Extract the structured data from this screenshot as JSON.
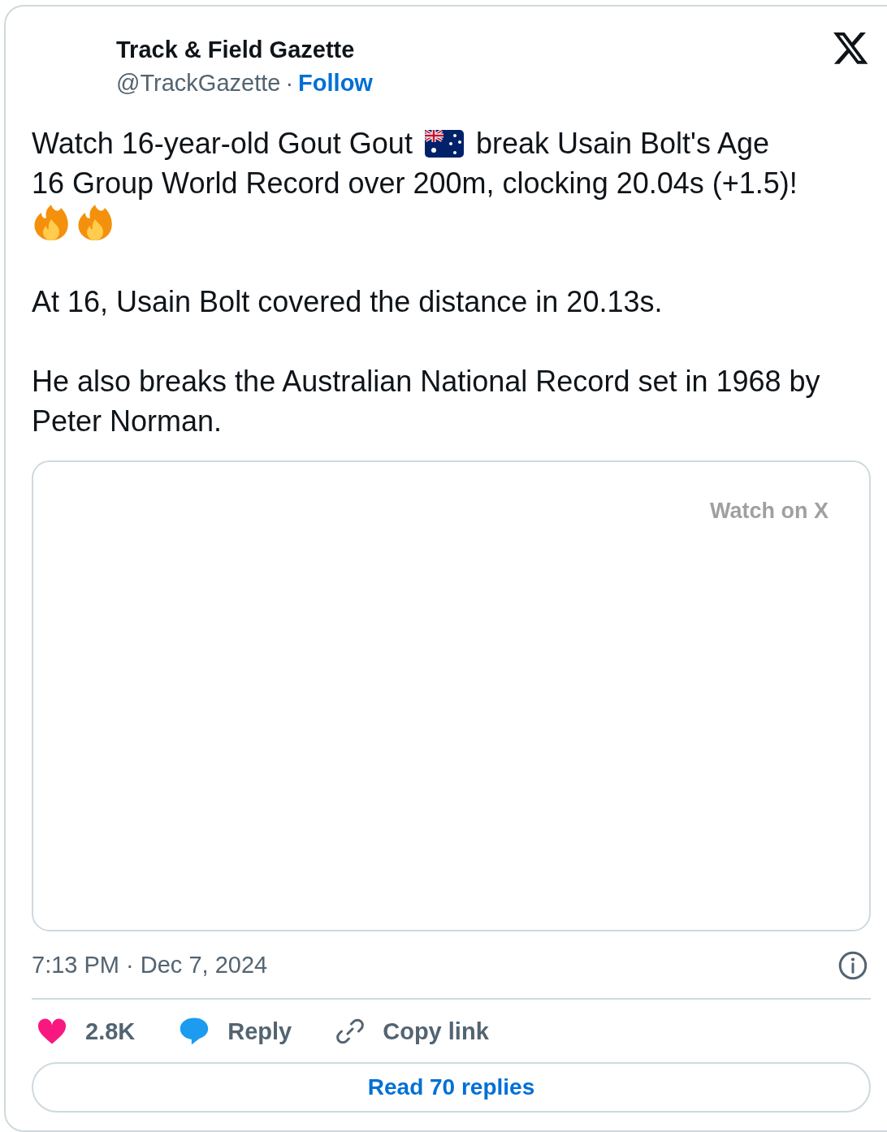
{
  "author": {
    "name": "Track & Field Gazette",
    "handle": "@TrackGazette",
    "separator": "·",
    "follow": "Follow"
  },
  "tweet": {
    "paragraph_1": {
      "before_flag": "Watch 16-year-old Gout Gout",
      "after_flag": "break Usain Bolt's Age",
      "continued": "16 Group World Record over 200m, clocking 20.04s (+1.5)!"
    },
    "paragraph_2": "At 16, Usain Bolt covered the distance in 20.13s.",
    "paragraph_3": "He also breaks the Australian National Record set in 1968 by Peter Norman."
  },
  "video": {
    "watch_label": "Watch on X"
  },
  "timestamp": "7:13 PM · Dec 7, 2024",
  "actions": [
    {
      "kind": "like",
      "label": "2.8K"
    },
    {
      "kind": "reply",
      "label": "Reply"
    },
    {
      "kind": "copy",
      "label": "Copy link"
    }
  ],
  "read_replies": "Read 70 replies"
}
